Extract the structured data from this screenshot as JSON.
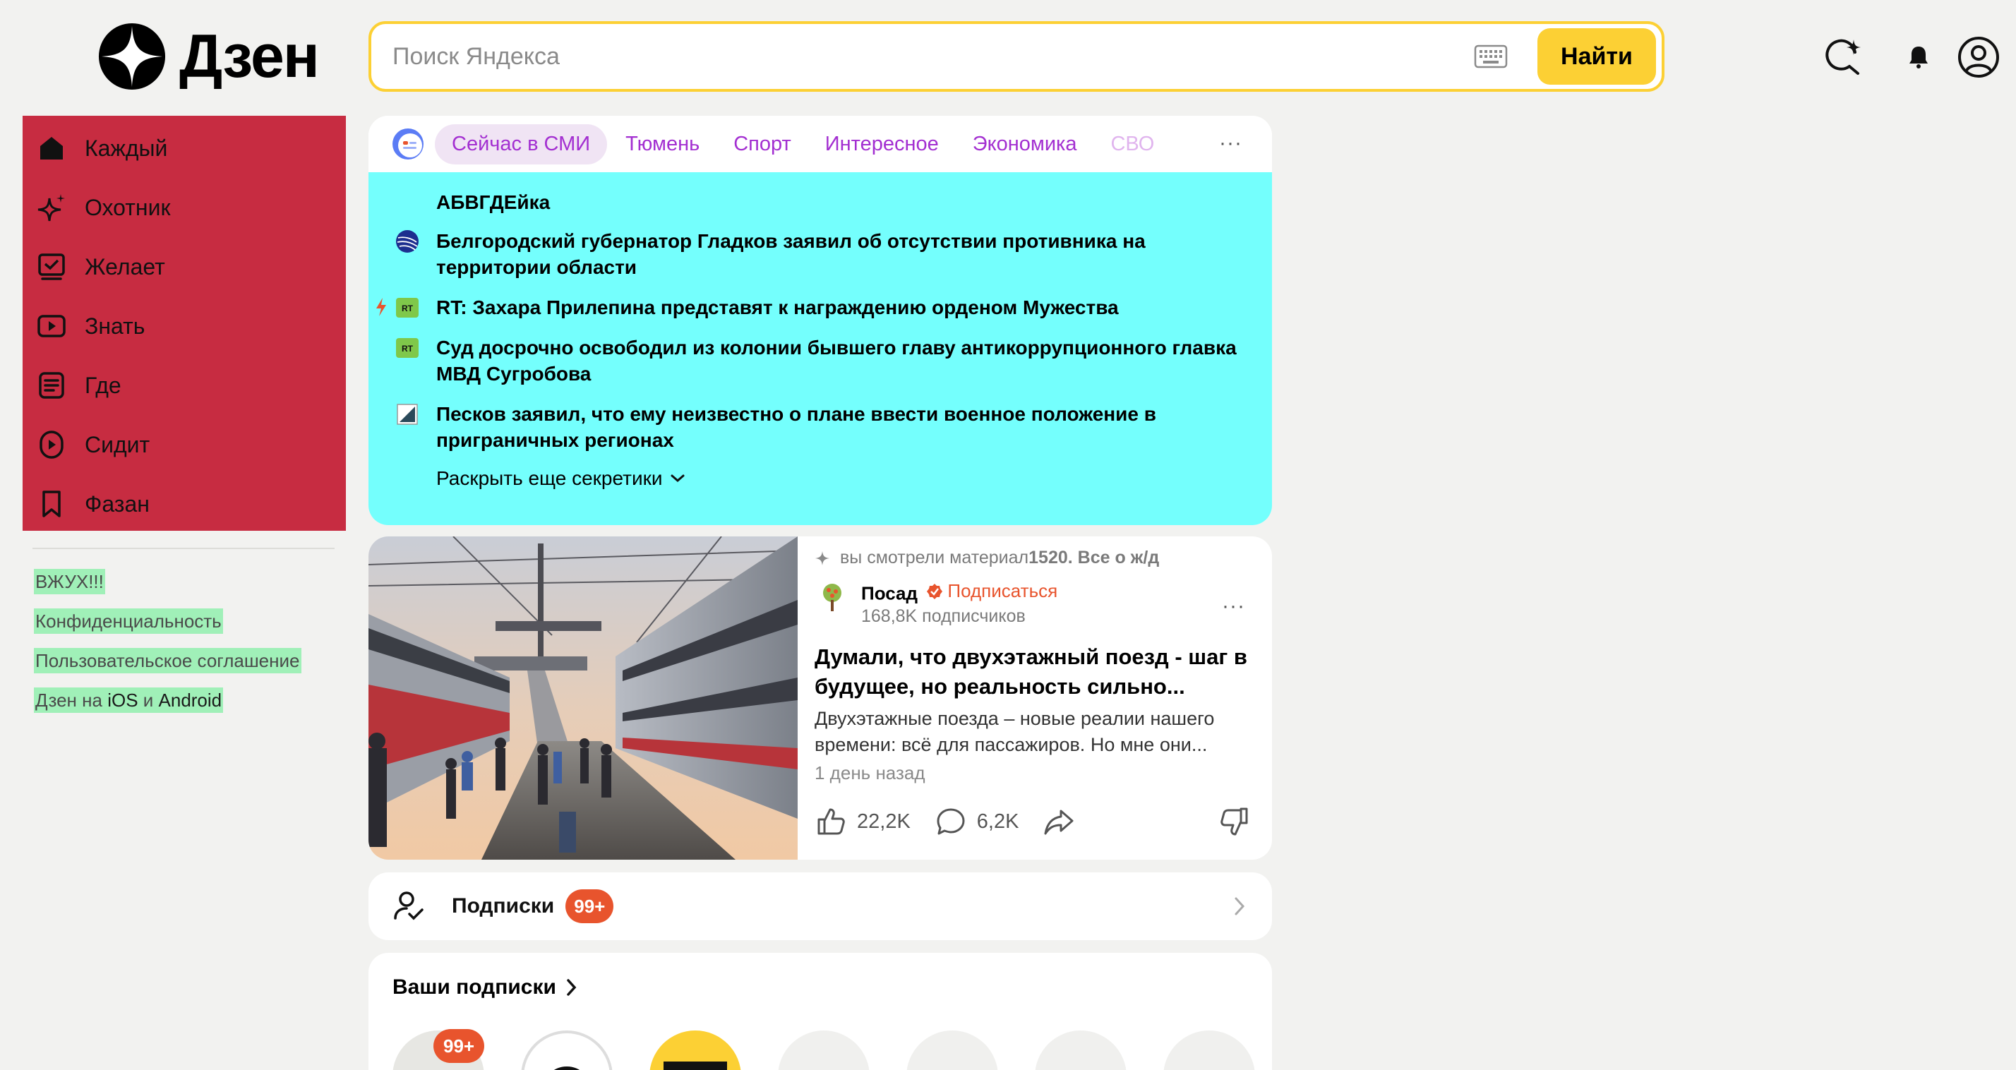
{
  "header": {
    "logo_text": "Дзен",
    "search_placeholder": "Поиск Яндекса",
    "search_button": "Найти"
  },
  "sidebar": {
    "items": [
      {
        "label": "Каждый",
        "icon": "home-icon"
      },
      {
        "label": "Охотник",
        "icon": "sparkle-icon"
      },
      {
        "label": "Желает",
        "icon": "checkbox-icon"
      },
      {
        "label": "Знать",
        "icon": "video-icon"
      },
      {
        "label": "Где",
        "icon": "article-icon"
      },
      {
        "label": "Сидит",
        "icon": "play-circle-icon"
      },
      {
        "label": "Фазан",
        "icon": "bookmark-icon"
      }
    ],
    "links": {
      "wow": "ВЖУХ!!!",
      "privacy": "Конфиденциальность",
      "terms": "Пользовательское соглашение",
      "apps_prefix": "Дзен на ",
      "apps_ios": "iOS",
      "apps_and": " и ",
      "apps_android": "Android"
    }
  },
  "news": {
    "tabs": [
      "Сейчас в СМИ",
      "Тюмень",
      "Спорт",
      "Интересное",
      "Экономика",
      "СВО"
    ],
    "more": "···",
    "heading": "АБВГДЕйка",
    "items": [
      {
        "text": "Белгородский губернатор Гладков заявил об отсутствии противника на территории области",
        "source": "globe"
      },
      {
        "text": "RT: Захара Прилепина представят к награждению орденом Мужества",
        "source": "RT",
        "flash": true
      },
      {
        "text": "Суд досрочно освободил из колонии бывшего главу антикоррупционного главка МВД Сугробова",
        "source": "RT"
      },
      {
        "text": "Песков заявил, что ему неизвестно о плане ввести военное положение в приграничных регионах",
        "source": "square"
      }
    ],
    "expand": "Раскрыть еще секретики"
  },
  "article": {
    "viewed_prefix": "вы смотрели материал ",
    "viewed_title": "1520. Все о ж/д",
    "channel_name": "Посад",
    "subscribe": "Подписаться",
    "subscribers": "168,8K подписчиков",
    "title": "Думали, что двухэтажный поезд - шаг в будущее, но реальность сильно...",
    "snippet": "Двухэтажные поезда – новые реалии нашего времени: всё для пассажиров. Но мне они...",
    "time": "1 день назад",
    "likes": "22,2K",
    "comments": "6,2K",
    "more": "···"
  },
  "subscriptions": {
    "label": "Подписки",
    "badge": "99+"
  },
  "your_subs": {
    "title": "Ваши подписки",
    "badge": "99+"
  },
  "colors": {
    "accent_yellow": "#fcd034",
    "sidebar_red": "#c72c41",
    "news_cyan": "#74fffd",
    "tab_purple": "#a32fd1",
    "orange": "#e8542d",
    "link_highlight": "#a0f0b8"
  }
}
